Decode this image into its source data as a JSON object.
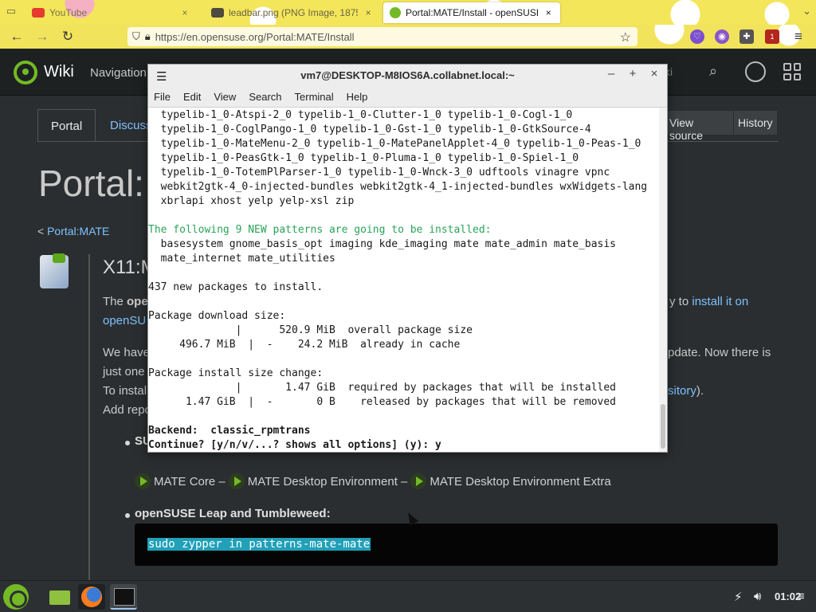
{
  "browser": {
    "tabs": [
      {
        "title": "YouTube",
        "close": "×"
      },
      {
        "title": "leadbar.png (PNG Image, 1875",
        "close": "×"
      },
      {
        "title": "Portal:MATE/Install - openSUSE",
        "close": "×"
      }
    ],
    "url": "https://en.opensuse.org/Portal:MATE/Install",
    "ext_badge": "1"
  },
  "wiki": {
    "site_title": "Wiki",
    "nav_label": "Navigation",
    "search_hint": "ki",
    "tabs": {
      "portal": "Portal",
      "discussion": "Discuss",
      "view_source": "View source",
      "history": "History"
    },
    "page_title": "Portal:",
    "breadcrumb_prefix": "<",
    "breadcrumb_link": "Portal:MATE",
    "heading": "X11:M",
    "para1_start": "The ",
    "para1_bold": "ope",
    "para1_link_end": "install it on",
    "para1_link_start": "openSU",
    "para1_to": "y to",
    "para2_line1": "We have",
    "para2_line1_end": "pdate. Now there is",
    "para2_line2": "just one",
    "para2_line3": "To instal",
    "para2_line3_link": "sitory",
    "para2_line3_end": ").",
    "para2_line4": "Add repo",
    "su_label": "SU",
    "oneclick": [
      "MATE Core –",
      "MATE Desktop Environment –",
      "MATE Desktop Environment Extra"
    ],
    "leap_label": "openSUSE Leap and Tumbleweed:",
    "command": "sudo zypper in patterns-mate-mate"
  },
  "terminal": {
    "title": "vm7@DESKTOP-M8IOS6A.collabnet.local:~",
    "menu": [
      "File",
      "Edit",
      "View",
      "Search",
      "Terminal",
      "Help"
    ],
    "lines": [
      "  typelib-1_0-Atspi-2_0 typelib-1_0-Clutter-1_0 typelib-1_0-Cogl-1_0",
      "  typelib-1_0-CoglPango-1_0 typelib-1_0-Gst-1_0 typelib-1_0-GtkSource-4",
      "  typelib-1_0-MateMenu-2_0 typelib-1_0-MatePanelApplet-4_0 typelib-1_0-Peas-1_0",
      "  typelib-1_0-PeasGtk-1_0 typelib-1_0-Pluma-1_0 typelib-1_0-Spiel-1_0",
      "  typelib-1_0-TotemPlParser-1_0 typelib-1_0-Wnck-3_0 udftools vinagre vpnc",
      "  webkit2gtk-4_0-injected-bundles webkit2gtk-4_1-injected-bundles wxWidgets-lang",
      "  xbrlapi xhost yelp yelp-xsl zip",
      "",
      "The following 9 NEW patterns are going to be installed:",
      "  basesystem gnome_basis_opt imaging kde_imaging mate mate_admin mate_basis",
      "  mate_internet mate_utilities",
      "",
      "437 new packages to install.",
      "",
      "Package download size:",
      "              |      520.9 MiB  overall package size",
      "     496.7 MiB  |  -    24.2 MiB  already in cache",
      "",
      "Package install size change:",
      "              |       1.47 GiB  required by packages that will be installed",
      "      1.47 GiB  |  -       0 B    released by packages that will be removed",
      "",
      "Backend:  classic_rpmtrans",
      "Continue? [y/n/v/...? shows all options] (y): y"
    ]
  },
  "taskbar": {
    "clock": "01:02"
  }
}
